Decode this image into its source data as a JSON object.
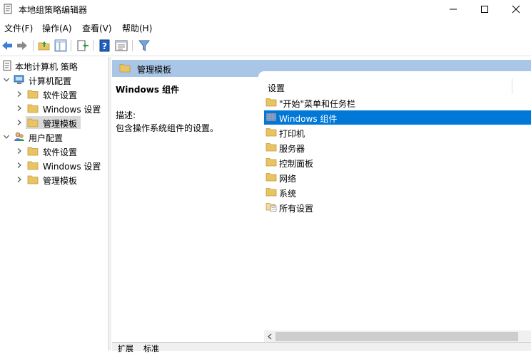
{
  "window": {
    "title": "本地组策略编辑器",
    "icons": {
      "app": "policy-editor-icon",
      "minimize": "minimize-icon",
      "maximize": "maximize-icon",
      "close": "close-icon"
    }
  },
  "menu": [
    {
      "label": "文件(F)"
    },
    {
      "label": "操作(A)"
    },
    {
      "label": "查看(V)"
    },
    {
      "label": "帮助(H)"
    }
  ],
  "toolbar": {
    "buttons": [
      "back-icon",
      "forward-icon",
      "up-folder-icon",
      "show-hide-tree-icon",
      "export-list-icon",
      "help-icon",
      "properties-icon",
      "filter-icon"
    ]
  },
  "tree": {
    "root": "本地计算机 策略",
    "computer_config": "计算机配置",
    "computer_children": [
      "软件设置",
      "Windows 设置",
      "管理模板"
    ],
    "user_config": "用户配置",
    "user_children": [
      "软件设置",
      "Windows 设置",
      "管理模板"
    ]
  },
  "right_header": {
    "title": "管理模板"
  },
  "description": {
    "heading": "Windows 组件",
    "label": "描述:",
    "text": "包含操作系统组件的设置。"
  },
  "settings_list": {
    "column_header": "设置",
    "items": [
      {
        "label": "\"开始\"菜单和任务栏",
        "icon": "folder-icon"
      },
      {
        "label": "Windows 组件",
        "icon": "windows-components-icon",
        "selected": true
      },
      {
        "label": "打印机",
        "icon": "folder-icon"
      },
      {
        "label": "服务器",
        "icon": "folder-icon"
      },
      {
        "label": "控制面板",
        "icon": "folder-icon"
      },
      {
        "label": "网络",
        "icon": "folder-icon"
      },
      {
        "label": "系统",
        "icon": "folder-icon"
      },
      {
        "label": "所有设置",
        "icon": "all-settings-icon"
      }
    ]
  },
  "bottom_tabs": [
    "扩展",
    "标准"
  ],
  "colors": {
    "header_bg": "#aac6e6",
    "selection": "#0078d7",
    "folder": "#e8c463"
  }
}
